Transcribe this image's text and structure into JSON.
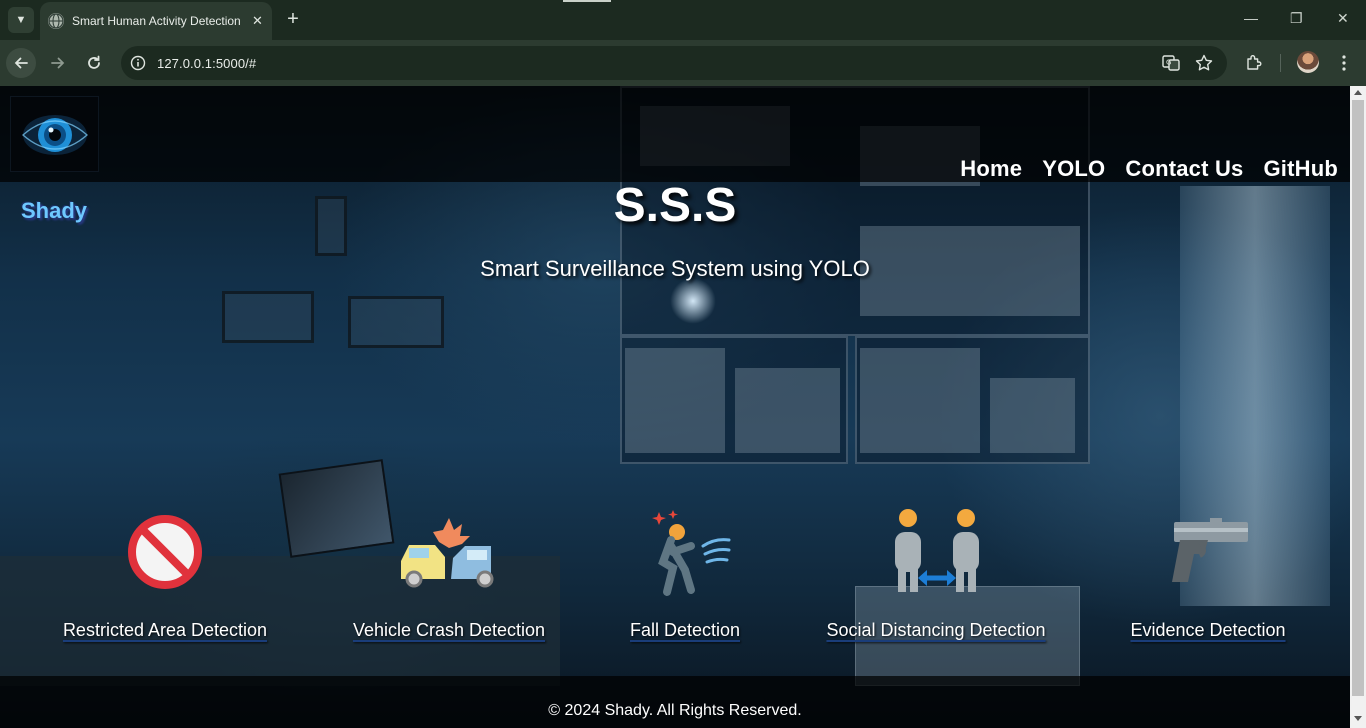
{
  "browser": {
    "tab_title": "Smart Human Activity Detection",
    "url": "127.0.0.1:5000/#",
    "icons": [
      "tab-list-icon",
      "globe-icon",
      "close-icon",
      "plus-icon",
      "back-arrow-icon",
      "forward-arrow-icon",
      "reload-icon",
      "info-icon",
      "translate-icon",
      "star-icon",
      "extensions-icon",
      "profile-avatar",
      "more-vert-icon",
      "minimize-icon",
      "restore-icon",
      "close-window-icon"
    ]
  },
  "site": {
    "brand": "Shady",
    "nav": [
      "Home",
      "YOLO",
      "Contact Us",
      "GitHub"
    ],
    "title": "S.S.S",
    "subtitle": "Smart Surveillance System using YOLO",
    "features": [
      {
        "label": "Restricted Area Detection",
        "icon": "no-entry-icon"
      },
      {
        "label": "Vehicle Crash Detection",
        "icon": "car-crash-icon"
      },
      {
        "label": "Fall Detection",
        "icon": "person-falling-icon"
      },
      {
        "label": "Social Distancing Detection",
        "icon": "social-distance-icon"
      },
      {
        "label": "Evidence Detection",
        "icon": "pistol-icon"
      }
    ],
    "footer": "© 2024 Shady. All Rights Reserved."
  },
  "colors": {
    "brand_text": "#6ec8ff",
    "header_bg": "#000000",
    "chrome_bg": "#1c2a20"
  }
}
